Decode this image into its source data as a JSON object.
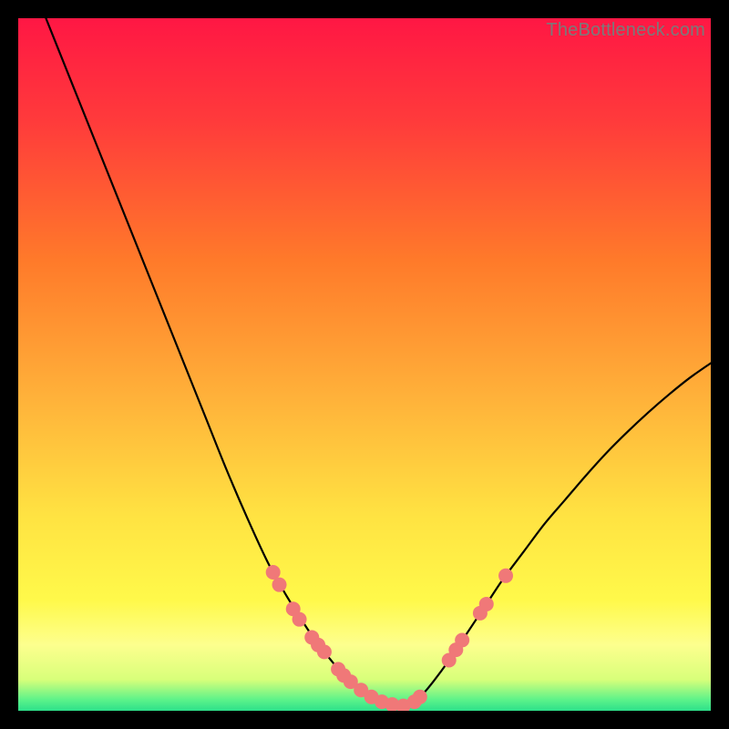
{
  "watermark": "TheBottleneck.com",
  "chart_data": {
    "type": "line",
    "title": "",
    "xlabel": "",
    "ylabel": "",
    "xlim": [
      0,
      100
    ],
    "ylim": [
      0,
      100
    ],
    "grid": false,
    "legend": false,
    "background_gradient": {
      "stops": [
        {
          "offset": 0.0,
          "color": "#ff1744"
        },
        {
          "offset": 0.15,
          "color": "#ff3b3b"
        },
        {
          "offset": 0.35,
          "color": "#ff7a2a"
        },
        {
          "offset": 0.55,
          "color": "#ffb23a"
        },
        {
          "offset": 0.72,
          "color": "#ffe342"
        },
        {
          "offset": 0.84,
          "color": "#fff94a"
        },
        {
          "offset": 0.905,
          "color": "#fdff8e"
        },
        {
          "offset": 0.955,
          "color": "#d8ff7a"
        },
        {
          "offset": 0.985,
          "color": "#59f28a"
        },
        {
          "offset": 1.0,
          "color": "#2de08a"
        }
      ]
    },
    "series": [
      {
        "name": "left-curve",
        "stroke": "#000000",
        "x": [
          4,
          6,
          9,
          12,
          15,
          18,
          21,
          24,
          27,
          30,
          33,
          36,
          38.5,
          41,
          43,
          45,
          46.5,
          48,
          49.5,
          51,
          52.5,
          54,
          55.5
        ],
        "y": [
          100,
          95,
          87.5,
          80,
          72.5,
          65,
          57.5,
          50,
          42.5,
          35,
          28,
          21.5,
          17,
          13,
          10,
          7.5,
          5.7,
          4.2,
          3.0,
          2.0,
          1.3,
          0.8,
          0.5
        ]
      },
      {
        "name": "right-curve",
        "stroke": "#000000",
        "x": [
          55.5,
          57,
          58.5,
          60,
          62,
          64,
          66,
          68,
          70,
          73,
          76,
          79,
          82,
          85,
          88,
          91,
          94,
          97,
          100
        ],
        "y": [
          0.5,
          1.2,
          2.5,
          4.3,
          7.0,
          10.0,
          13.0,
          16.0,
          19.0,
          23.0,
          27.0,
          30.5,
          34.0,
          37.3,
          40.3,
          43.1,
          45.7,
          48.1,
          50.2
        ]
      }
    ],
    "dot_markers": {
      "color": "#f07878",
      "radius_px": 8,
      "points": [
        {
          "x": 36.8,
          "y": 20.0
        },
        {
          "x": 37.7,
          "y": 18.2
        },
        {
          "x": 39.7,
          "y": 14.7
        },
        {
          "x": 40.6,
          "y": 13.2
        },
        {
          "x": 42.4,
          "y": 10.6
        },
        {
          "x": 43.3,
          "y": 9.5
        },
        {
          "x": 44.2,
          "y": 8.5
        },
        {
          "x": 46.2,
          "y": 6.0
        },
        {
          "x": 47.0,
          "y": 5.1
        },
        {
          "x": 48.0,
          "y": 4.2
        },
        {
          "x": 49.5,
          "y": 3.0
        },
        {
          "x": 51.0,
          "y": 2.0
        },
        {
          "x": 52.5,
          "y": 1.3
        },
        {
          "x": 54.0,
          "y": 0.9
        },
        {
          "x": 55.6,
          "y": 0.7
        },
        {
          "x": 57.2,
          "y": 1.3
        },
        {
          "x": 58.0,
          "y": 2.0
        },
        {
          "x": 62.2,
          "y": 7.3
        },
        {
          "x": 63.2,
          "y": 8.8
        },
        {
          "x": 64.1,
          "y": 10.2
        },
        {
          "x": 66.7,
          "y": 14.1
        },
        {
          "x": 67.6,
          "y": 15.4
        },
        {
          "x": 70.4,
          "y": 19.5
        }
      ]
    }
  }
}
